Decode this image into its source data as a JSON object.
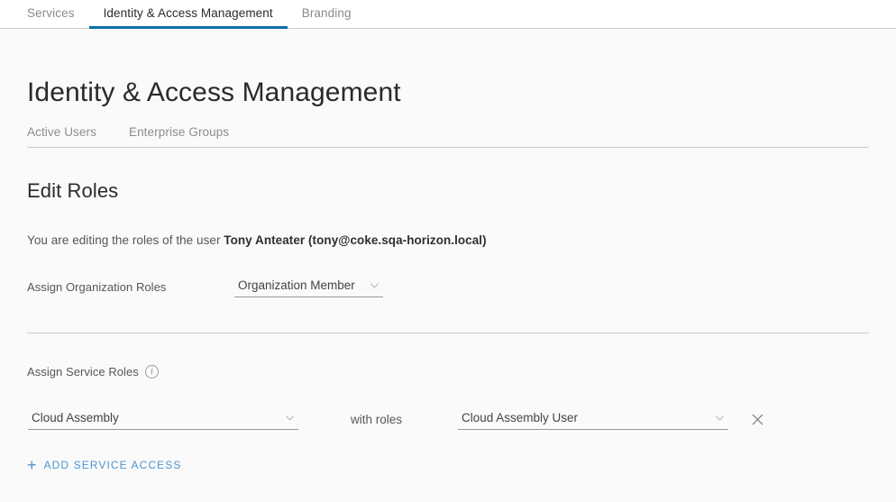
{
  "header": {
    "tabs": [
      {
        "label": "Services",
        "active": false
      },
      {
        "label": "Identity & Access Management",
        "active": true
      },
      {
        "label": "Branding",
        "active": false
      }
    ],
    "active_underline_color": "#0b6cab"
  },
  "page": {
    "title": "Identity & Access Management",
    "subtabs": [
      {
        "label": "Active Users"
      },
      {
        "label": "Enterprise Groups"
      }
    ]
  },
  "edit_roles": {
    "section_title": "Edit Roles",
    "description_prefix": "You are editing the roles of the user ",
    "description_user": "Tony Anteater (tony@coke.sqa-horizon.local)",
    "organization": {
      "label": "Assign Organization Roles",
      "selected": "Organization Member"
    },
    "service": {
      "label": "Assign Service Roles",
      "info_icon": "info-icon",
      "info_glyph": "i",
      "with_roles_label": "with roles",
      "rows": [
        {
          "service": "Cloud Assembly",
          "role": "Cloud Assembly User",
          "remove_label": "×"
        }
      ],
      "add_label": "Add Service Access",
      "add_plus": "+",
      "add_link_color": "#4f94cd"
    }
  }
}
